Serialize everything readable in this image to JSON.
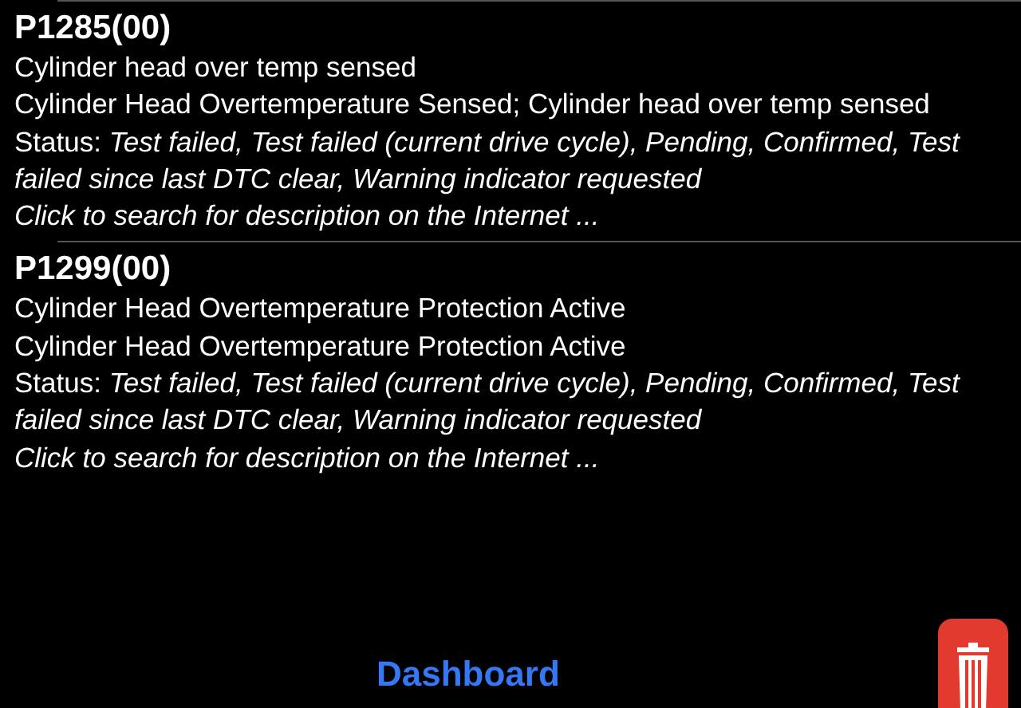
{
  "codes": [
    {
      "code": "P1285(00)",
      "lines": [
        "Cylinder head over temp sensed",
        "Cylinder Head Overtemperature Sensed; Cylinder head over temp sensed"
      ],
      "status": "Status: *Test failed, Test failed (current drive cycle), Pending, Confirmed, Test failed since last DTC clear, Warning indicator requested*",
      "link": "Click to search for description on the Internet ..."
    },
    {
      "code": "P1299(00)",
      "lines": [
        "Cylinder Head Overtemperature Protection Active",
        "Cylinder Head Overtemperature Protection Active"
      ],
      "status": "Status: *Test failed, Test failed (current drive cycle), Pending, Confirmed, Test failed since last DTC clear, Warning indicator requested*",
      "link": "Click to search for description on the Internet ..."
    }
  ],
  "footer": {
    "button": "Dashboard"
  }
}
